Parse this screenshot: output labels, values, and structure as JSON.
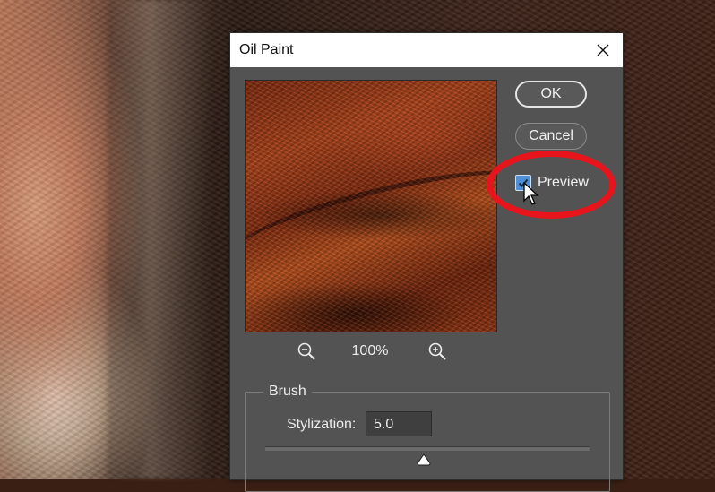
{
  "dialog": {
    "title": "Oil Paint",
    "ok_label": "OK",
    "cancel_label": "Cancel",
    "preview_label": "Preview",
    "preview_checked": true,
    "zoom_level": "100%"
  },
  "brush": {
    "group_label": "Brush",
    "stylization_label": "Stylization:",
    "stylization_value": "5.0",
    "stylization_fraction": 0.49
  },
  "icons": {
    "close": "close-icon",
    "zoom_out": "zoom-out-icon",
    "zoom_in": "zoom-in-icon",
    "check": "checkmark-icon",
    "cursor": "mouse-pointer-icon"
  },
  "colors": {
    "dialog_bg": "#535353",
    "titlebar_bg": "#ffffff",
    "checkbox_blue": "#4d8fd8",
    "highlight_red": "#e8141c"
  }
}
